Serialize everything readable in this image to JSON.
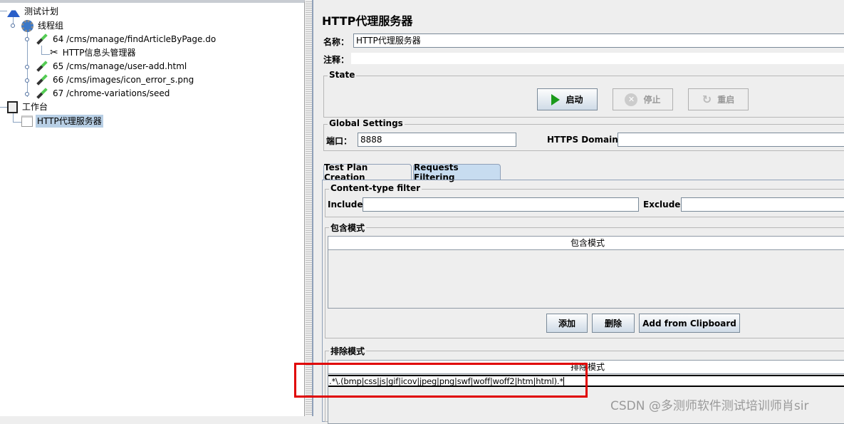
{
  "tree": {
    "items": [
      {
        "label": "测试计划",
        "icon": "test-plan-flask-icon"
      },
      {
        "label": "线程组",
        "icon": "thread-group-gear-icon"
      },
      {
        "label": "64 /cms/manage/findArticleByPage.do",
        "icon": "sampler-pipette-icon"
      },
      {
        "label": "HTTP信息头管理器",
        "icon": "header-manager-tools-icon"
      },
      {
        "label": "65 /cms/manage/user-add.html",
        "icon": "sampler-pipette-icon"
      },
      {
        "label": "66 /cms/images/icon_error_s.png",
        "icon": "sampler-pipette-icon"
      },
      {
        "label": "67 /chrome-variations/seed",
        "icon": "sampler-pipette-icon"
      },
      {
        "label": "工作台",
        "icon": "workbench-icon"
      },
      {
        "label": "HTTP代理服务器",
        "icon": "proxy-server-icon",
        "selected": true
      }
    ]
  },
  "panel": {
    "title": "HTTP代理服务器",
    "name_label": "名称：",
    "name_value": "HTTP代理服务器",
    "comment_label": "注释：",
    "comment_value": "",
    "state": {
      "label": "State",
      "start": "启动",
      "stop": "停止",
      "restart": "重启"
    },
    "global": {
      "label": "Global Settings",
      "port_label": "端口：",
      "port_value": "8888",
      "https_label": "HTTPS Domains:",
      "https_value": ""
    },
    "tabs": [
      {
        "label": "Test Plan Creation"
      },
      {
        "label": "Requests Filtering",
        "active": true
      }
    ],
    "content_type": {
      "label": "Content-type filter",
      "include_label": "Include:",
      "include_value": "",
      "exclude_label": "Exclude:",
      "exclude_value": ""
    },
    "include_patterns": {
      "label": "包含模式",
      "column": "包含模式",
      "rows": [],
      "add": "添加",
      "delete": "删除",
      "clipboard": "Add from Clipboard"
    },
    "exclude_patterns": {
      "label": "排除模式",
      "column": "排除模式",
      "rows": [
        ".*\\.(bmp|css|js|gif|icov|jpeg|png|swf|woff|woff2|htm|html).*"
      ]
    }
  },
  "annotation_color": "#e00000",
  "watermark": "CSDN @多测师软件测试培训师肖sir"
}
